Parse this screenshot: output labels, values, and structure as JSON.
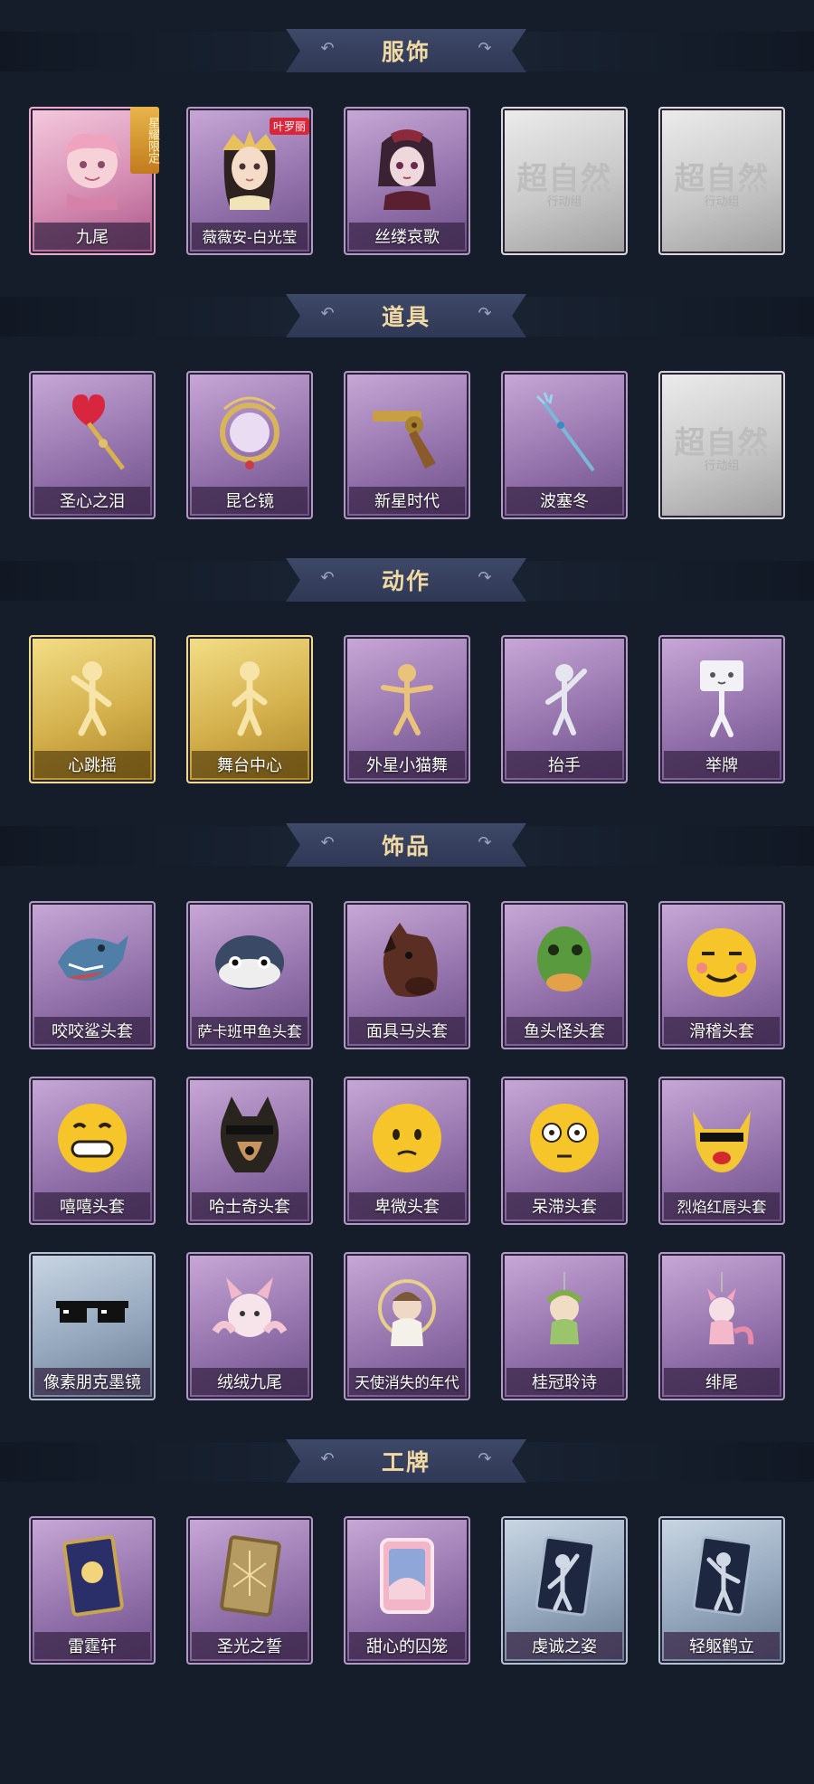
{
  "sections": [
    {
      "title": "服饰",
      "cards": [
        {
          "label": "九尾",
          "badge": "星耀限定",
          "icon": "fox-girl-portrait-icon"
        },
        {
          "label": "薇薇安-白光莹",
          "badge": "叶罗丽",
          "icon": "golden-crown-girl-portrait-icon"
        },
        {
          "label": "丝缕哀歌",
          "icon": "gothic-girl-portrait-icon"
        },
        {
          "label": "",
          "watermark": "超自然",
          "watermark_sub": "行动组",
          "icon": "placeholder-logo-icon"
        },
        {
          "label": "",
          "watermark": "超自然",
          "watermark_sub": "行动组",
          "icon": "placeholder-logo-icon"
        }
      ]
    },
    {
      "title": "道具",
      "cards": [
        {
          "label": "圣心之泪",
          "icon": "heart-scepter-icon"
        },
        {
          "label": "昆仑镜",
          "icon": "ornate-mirror-icon"
        },
        {
          "label": "新星时代",
          "icon": "revolver-icon"
        },
        {
          "label": "波塞冬",
          "icon": "trident-icon"
        },
        {
          "label": "",
          "watermark": "超自然",
          "watermark_sub": "行动组",
          "icon": "placeholder-logo-icon"
        }
      ]
    },
    {
      "title": "动作",
      "cards": [
        {
          "label": "心跳摇",
          "icon": "dance-pose-icon"
        },
        {
          "label": "舞台中心",
          "icon": "stage-pose-icon"
        },
        {
          "label": "外星小猫舞",
          "icon": "cat-dance-icon"
        },
        {
          "label": "抬手",
          "icon": "raise-hand-icon"
        },
        {
          "label": "举牌",
          "icon": "hold-sign-icon"
        }
      ]
    },
    {
      "title": "饰品",
      "cards": [
        {
          "label": "咬咬鲨头套",
          "icon": "shark-head-icon"
        },
        {
          "label": "萨卡班甲鱼头套",
          "icon": "fish-head-icon"
        },
        {
          "label": "面具马头套",
          "icon": "horse-head-icon"
        },
        {
          "label": "鱼头怪头套",
          "icon": "fish-monster-head-icon"
        },
        {
          "label": "滑稽头套",
          "icon": "funny-face-icon"
        },
        {
          "label": "嘻嘻头套",
          "icon": "grin-face-icon"
        },
        {
          "label": "哈士奇头套",
          "icon": "husky-head-icon"
        },
        {
          "label": "卑微头套",
          "icon": "humble-face-icon"
        },
        {
          "label": "呆滞头套",
          "icon": "dazed-face-icon"
        },
        {
          "label": "烈焰红唇头套",
          "icon": "red-lips-head-icon"
        },
        {
          "label": "像素朋克墨镜",
          "icon": "pixel-sunglasses-icon"
        },
        {
          "label": "绒绒九尾",
          "icon": "fluffy-fox-icon"
        },
        {
          "label": "天使消失的年代",
          "icon": "angel-charm-icon"
        },
        {
          "label": "桂冠聆诗",
          "icon": "laurel-charm-icon"
        },
        {
          "label": "绯尾",
          "icon": "pink-tail-charm-icon"
        }
      ]
    },
    {
      "title": "工牌",
      "cards": [
        {
          "label": "雷霆轩",
          "icon": "thunder-card-icon"
        },
        {
          "label": "圣光之誓",
          "icon": "holy-light-card-icon"
        },
        {
          "label": "甜心的囚笼",
          "icon": "sweetheart-card-icon"
        },
        {
          "label": "虔诚之姿",
          "icon": "pious-silhouette-card-icon"
        },
        {
          "label": "轻躯鹤立",
          "icon": "crane-silhouette-card-icon"
        }
      ]
    }
  ]
}
